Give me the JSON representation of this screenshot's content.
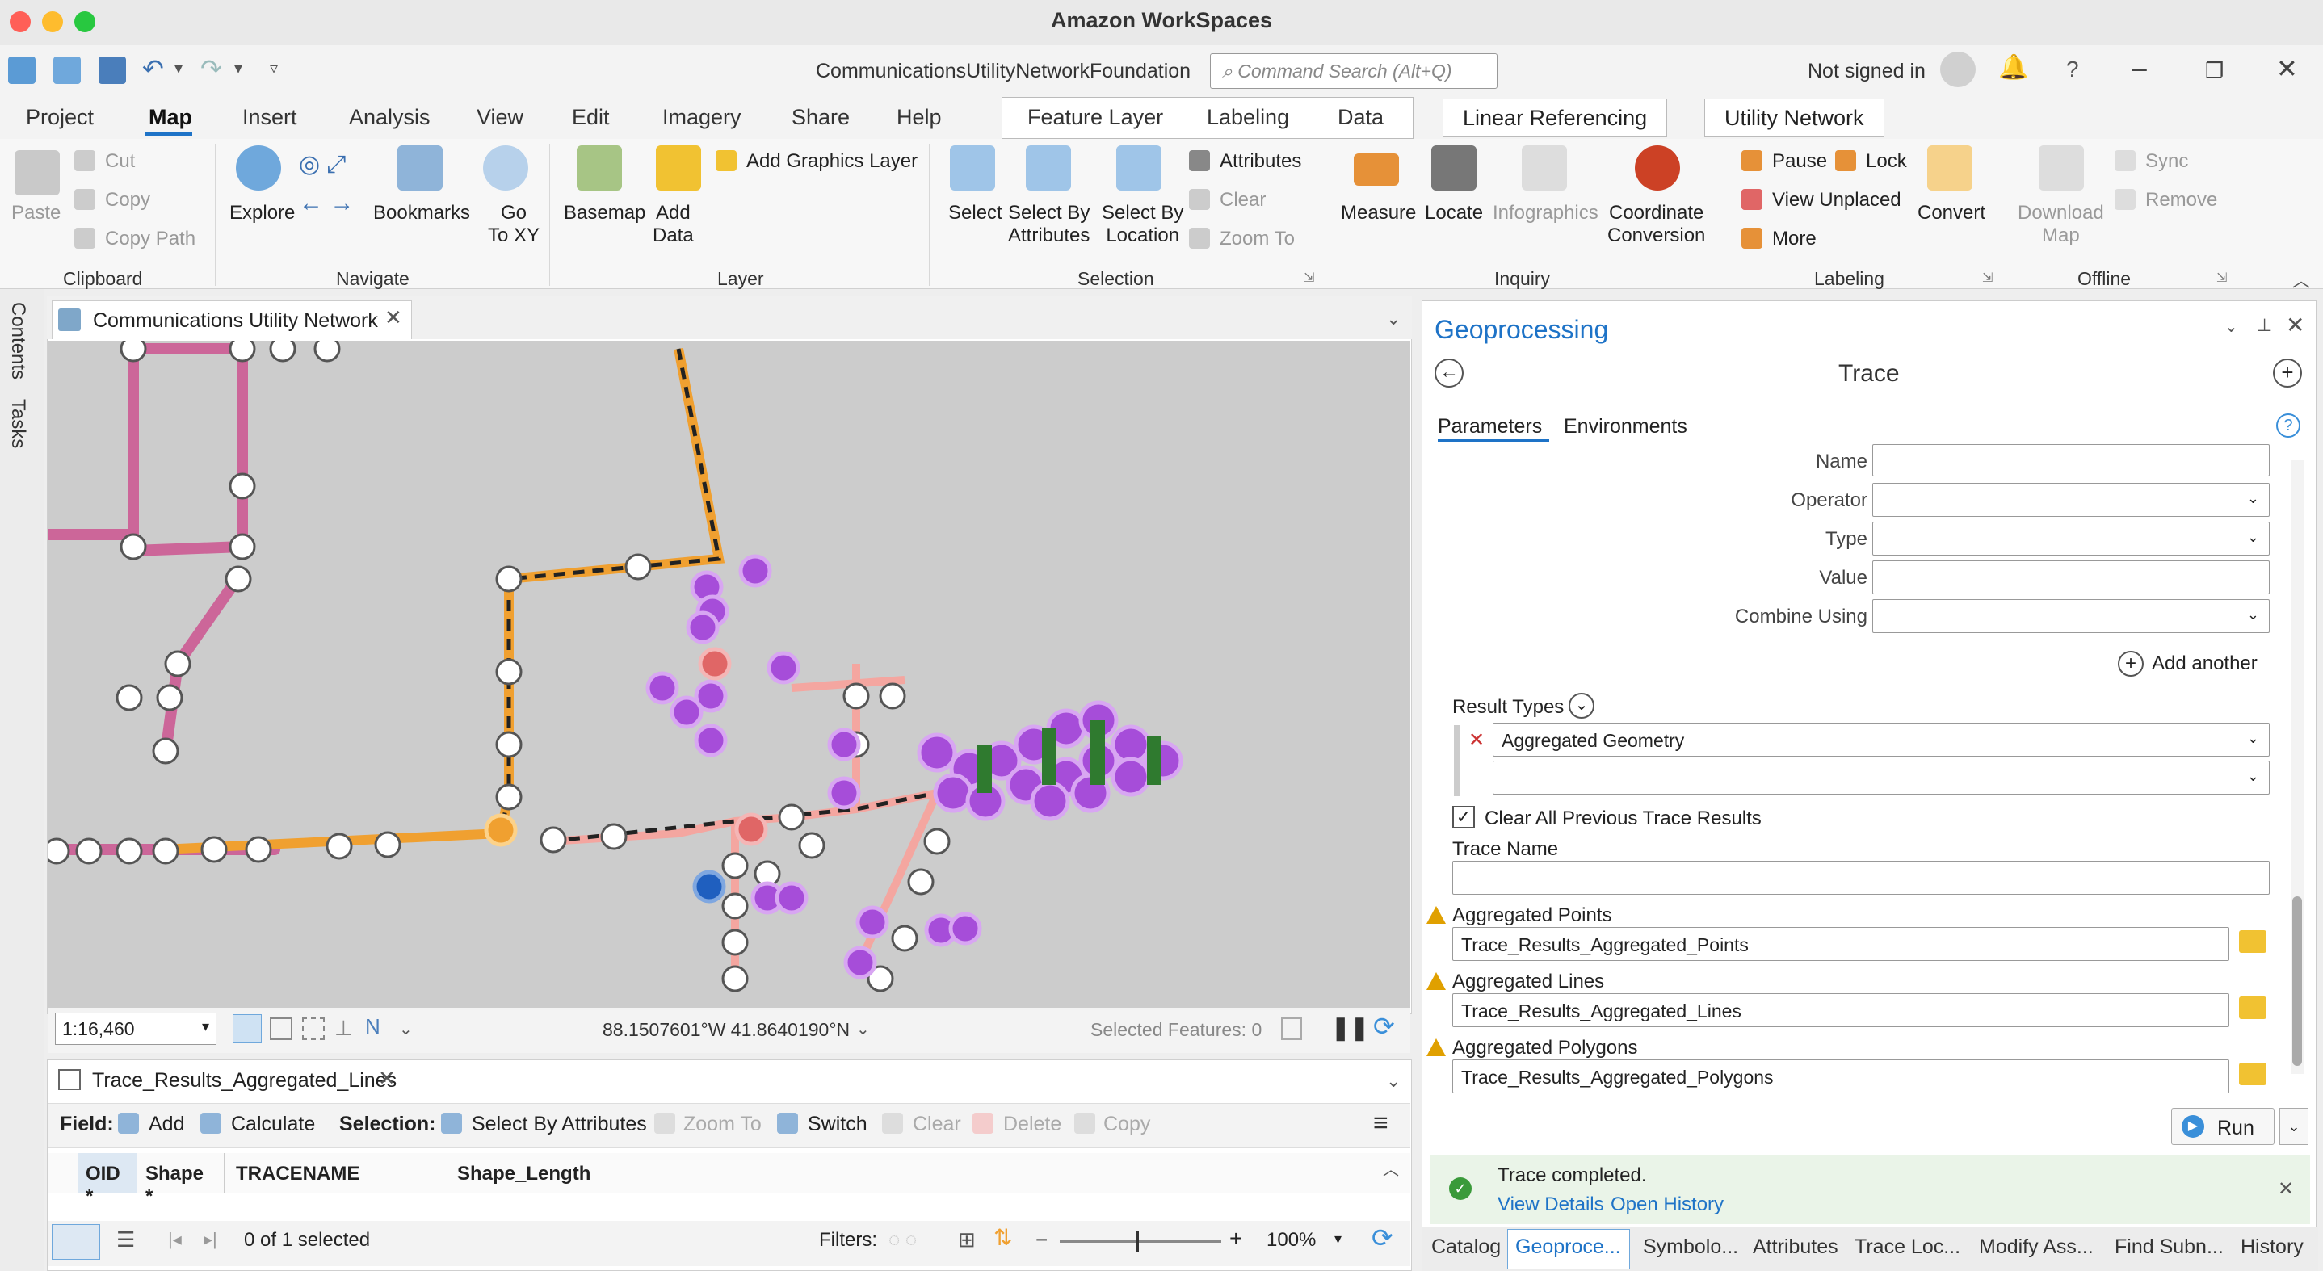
{
  "window": {
    "title": "Amazon WorkSpaces",
    "document": "CommunicationsUtilityNetworkFoundation",
    "search_placeholder": "Command Search (Alt+Q)",
    "signin": "Not signed in"
  },
  "tabs": [
    "Project",
    "Map",
    "Insert",
    "Analysis",
    "View",
    "Edit",
    "Imagery",
    "Share",
    "Help"
  ],
  "context_tabs": [
    "Feature Layer",
    "Labeling",
    "Data",
    "Linear Referencing",
    "Utility Network"
  ],
  "ribbon": {
    "clipboard": {
      "paste": "Paste",
      "cut": "Cut",
      "copy": "Copy",
      "copy_path": "Copy Path",
      "group": "Clipboard"
    },
    "navigate": {
      "explore": "Explore",
      "bookmarks": "Bookmarks",
      "go": "Go",
      "to_xy": "To XY",
      "group": "Navigate"
    },
    "layer": {
      "basemap": "Basemap",
      "add": "Add",
      "data": "Data",
      "add_graphics": "Add Graphics Layer",
      "group": "Layer"
    },
    "selection": {
      "select": "Select",
      "select_by": "Select By",
      "attributes": "Attributes",
      "select_by2": "Select By",
      "location": "Location",
      "attributes_btn": "Attributes",
      "clear": "Clear",
      "zoom_to": "Zoom To",
      "group": "Selection"
    },
    "inquiry": {
      "measure": "Measure",
      "locate": "Locate",
      "infographics": "Infographics",
      "coordinate": "Coordinate",
      "conversion": "Conversion",
      "group": "Inquiry"
    },
    "labeling": {
      "pause": "Pause",
      "lock": "Lock",
      "view_unplaced": "View Unplaced",
      "more": "More",
      "convert": "Convert",
      "group": "Labeling"
    },
    "offline": {
      "download": "Download",
      "map": "Map",
      "sync": "Sync",
      "remove": "Remove",
      "group": "Offline"
    }
  },
  "left_tabs": [
    "Contents",
    "Tasks"
  ],
  "map": {
    "tab": "Communications Utility Network",
    "scale": "1:16,460",
    "coords": "88.1507601°W 41.8640190°N",
    "selected": "Selected Features: 0"
  },
  "table": {
    "tab": "Trace_Results_Aggregated_Lines",
    "field_label": "Field:",
    "add": "Add",
    "calculate": "Calculate",
    "selection_label": "Selection:",
    "select_by_attributes": "Select By Attributes",
    "zoom_to": "Zoom To",
    "switch": "Switch",
    "clear": "Clear",
    "delete": "Delete",
    "copy": "Copy",
    "columns": [
      "OID *",
      "Shape *",
      "TRACENAME",
      "Shape_Length"
    ],
    "selected": "0 of 1 selected",
    "filters": "Filters:",
    "zoom": "100%"
  },
  "geoprocessing": {
    "title": "Geoprocessing",
    "tool": "Trace",
    "tab_params": "Parameters",
    "tab_env": "Environments",
    "fields": {
      "name": "Name",
      "operator": "Operator",
      "type": "Type",
      "value": "Value",
      "combine": "Combine Using"
    },
    "add_another": "Add another",
    "result_types_label": "Result Types",
    "result_type_value": "Aggregated Geometry",
    "clear_previous": "Clear All Previous Trace Results",
    "trace_name_label": "Trace Name",
    "agg_points_label": "Aggregated Points",
    "agg_points_value": "Trace_Results_Aggregated_Points",
    "agg_lines_label": "Aggregated Lines",
    "agg_lines_value": "Trace_Results_Aggregated_Lines",
    "agg_polys_label": "Aggregated Polygons",
    "agg_polys_value": "Trace_Results_Aggregated_Polygons",
    "run": "Run",
    "status": "Trace completed.",
    "view_details": "View Details",
    "open_history": "Open History"
  },
  "bottom_tabs": [
    "Catalog",
    "Geoproce...",
    "Symbolo...",
    "Attributes",
    "Trace Loc...",
    "Modify Ass...",
    "Find Subn...",
    "History"
  ]
}
